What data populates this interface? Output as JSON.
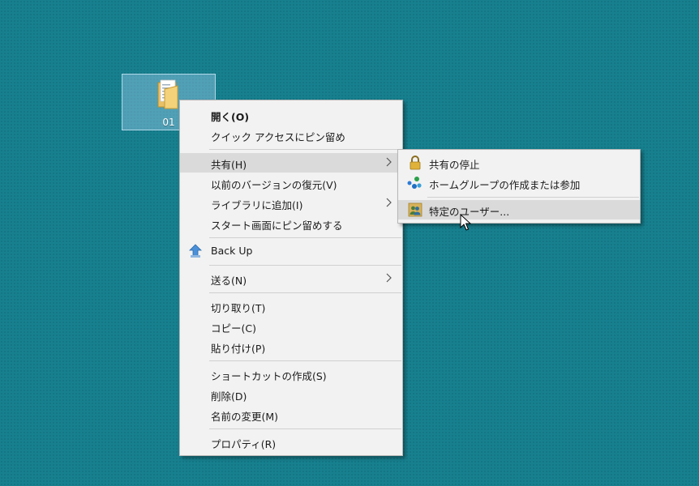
{
  "desktop": {
    "folder_label": "01",
    "folder_icon": "folder-icon"
  },
  "context_menu": {
    "items": [
      {
        "label": "開く(O)",
        "bold": true
      },
      {
        "label": "クイック アクセスにピン留め"
      },
      {
        "label": "共有(H)",
        "submenu": true,
        "highlighted": true
      },
      {
        "label": "以前のバージョンの復元(V)"
      },
      {
        "label": "ライブラリに追加(I)",
        "submenu": true
      },
      {
        "label": "スタート画面にピン留めする"
      },
      {
        "label": "Back Up",
        "icon": "backup-icon"
      },
      {
        "label": "送る(N)",
        "submenu": true
      },
      {
        "label": "切り取り(T)"
      },
      {
        "label": "コピー(C)"
      },
      {
        "label": "貼り付け(P)"
      },
      {
        "label": "ショートカットの作成(S)"
      },
      {
        "label": "削除(D)"
      },
      {
        "label": "名前の変更(M)"
      },
      {
        "label": "プロパティ(R)"
      }
    ]
  },
  "share_submenu": {
    "items": [
      {
        "label": "共有の停止",
        "icon": "lock-icon"
      },
      {
        "label": "ホームグループの作成または参加",
        "icon": "homegroup-icon"
      },
      {
        "label": "特定のユーザー...",
        "icon": "users-icon",
        "highlighted": true
      }
    ]
  },
  "colors": {
    "desktop_background": "#17808f",
    "menu_background": "#f2f2f2",
    "menu_highlight": "#dadada",
    "separator": "#d0d0d0"
  },
  "cursor_icon": "mouse-pointer-icon"
}
